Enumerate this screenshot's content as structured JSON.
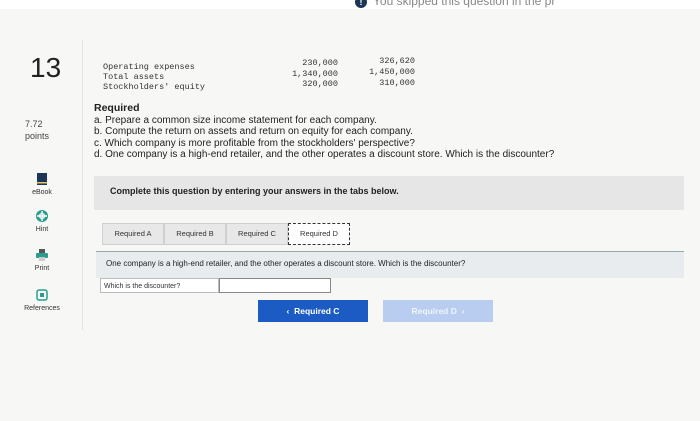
{
  "header": {
    "skip_notice": "You skipped this question in the pr"
  },
  "question": {
    "number": "13",
    "points": "7.72\npoints"
  },
  "tools": [
    {
      "label": "eBook",
      "icon": "ebook-icon"
    },
    {
      "label": "Hint",
      "icon": "hint-icon"
    },
    {
      "label": "Print",
      "icon": "print-icon"
    },
    {
      "label": "References",
      "icon": "references-icon"
    }
  ],
  "financials": {
    "rows": [
      {
        "label": "Operating expenses",
        "col1": "230,000",
        "col2": "326,620"
      },
      {
        "label": "Total assets",
        "col1": "1,340,000",
        "col2": "1,450,000"
      },
      {
        "label": "Stockholders' equity",
        "col1": "320,000",
        "col2": "310,000"
      }
    ]
  },
  "required": {
    "heading": "Required",
    "items": [
      "a. Prepare a common size income statement for each company.",
      "b. Compute the return on assets and return on equity for each company.",
      "c. Which company is more profitable from the stockholders' perspective?",
      "d. One company is a high-end retailer, and the other operates a discount store. Which is the discounter?"
    ]
  },
  "panel": {
    "instruction": "Complete this question by entering your answers in the tabs below."
  },
  "tabs": [
    "Required A",
    "Required B",
    "Required C",
    "Required D"
  ],
  "question_bar": {
    "text": "One company is a high-end retailer, and the other operates a discount store. Which is the discounter?"
  },
  "answer": {
    "label": "Which is the discounter?",
    "value": ""
  },
  "nav": {
    "prev_label": "Required C",
    "next_label": "Required D"
  },
  "colors": {
    "primary": "#1c5bc4",
    "disabled": "#b8cdf0"
  }
}
